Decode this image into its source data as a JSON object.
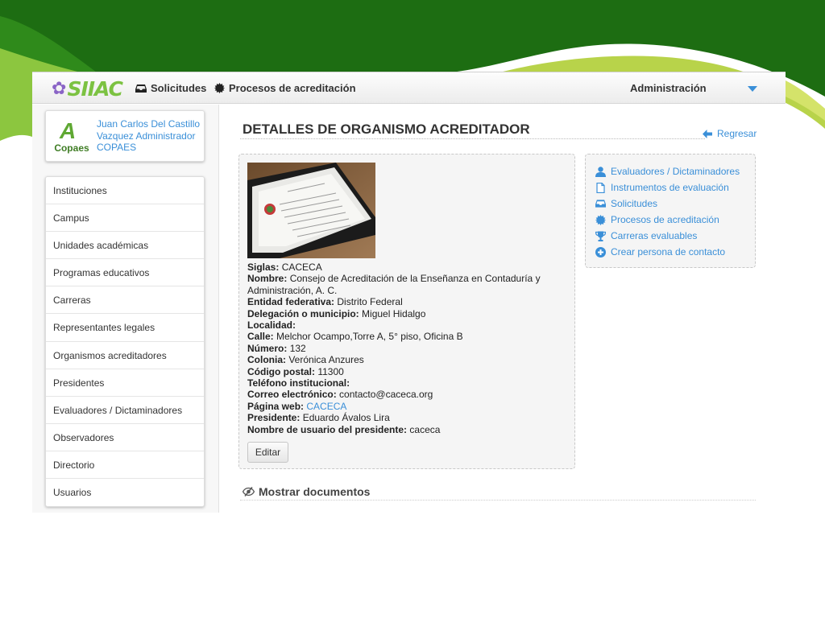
{
  "nav": {
    "logo": "SIIAC",
    "items": [
      {
        "label": "Solicitudes",
        "icon": "inbox-icon"
      },
      {
        "label": "Procesos de acreditación",
        "icon": "gear-icon"
      }
    ],
    "admin": "Administración"
  },
  "user": {
    "org_logo": "Copaes",
    "name": "Juan Carlos Del Castillo Vazquez Administrador COPAES"
  },
  "sidebar": {
    "items": [
      "Instituciones",
      "Campus",
      "Unidades académicas",
      "Programas educativos",
      "Carreras",
      "Representantes legales",
      "Organismos acreditadores",
      "Presidentes",
      "Evaluadores / Dictaminadores",
      "Observadores",
      "Directorio",
      "Usuarios"
    ]
  },
  "page": {
    "title": "DETALLES DE ORGANISMO ACREDITADOR",
    "back": "Regresar"
  },
  "details": {
    "siglas_label": "Siglas:",
    "siglas": "CACECA",
    "nombre_label": "Nombre:",
    "nombre": "Consejo de Acreditación de la Enseñanza en Contaduría y Administración, A. C.",
    "entidad_label": "Entidad federativa:",
    "entidad": "Distrito Federal",
    "delegacion_label": "Delegación o municipio:",
    "delegacion": "Miguel Hidalgo",
    "localidad_label": "Localidad:",
    "localidad": "",
    "calle_label": "Calle:",
    "calle": "Melchor Ocampo,Torre A, 5° piso, Oficina B",
    "numero_label": "Número:",
    "numero": "132",
    "colonia_label": "Colonia:",
    "colonia": "Verónica Anzures",
    "cp_label": "Código postal:",
    "cp": "11300",
    "telefono_label": "Teléfono institucional:",
    "telefono": "",
    "correo_label": "Correo electrónico:",
    "correo": "contacto@caceca.org",
    "web_label": "Página web:",
    "web": "CACECA",
    "presidente_label": "Presidente:",
    "presidente": "Eduardo Ávalos Lira",
    "usuario_label": "Nombre de usuario del presidente:",
    "usuario": "caceca",
    "edit_button": "Editar"
  },
  "links": [
    {
      "label": "Evaluadores / Dictaminadores",
      "icon": "user-icon"
    },
    {
      "label": "Instrumentos de evaluación",
      "icon": "document-icon"
    },
    {
      "label": "Solicitudes",
      "icon": "inbox-icon"
    },
    {
      "label": "Procesos de acreditación",
      "icon": "gear-icon"
    },
    {
      "label": "Carreras evaluables",
      "icon": "trophy-icon"
    },
    {
      "label": "Crear persona de contacto",
      "icon": "plus-circle-icon"
    }
  ],
  "show_documents": "Mostrar documentos"
}
